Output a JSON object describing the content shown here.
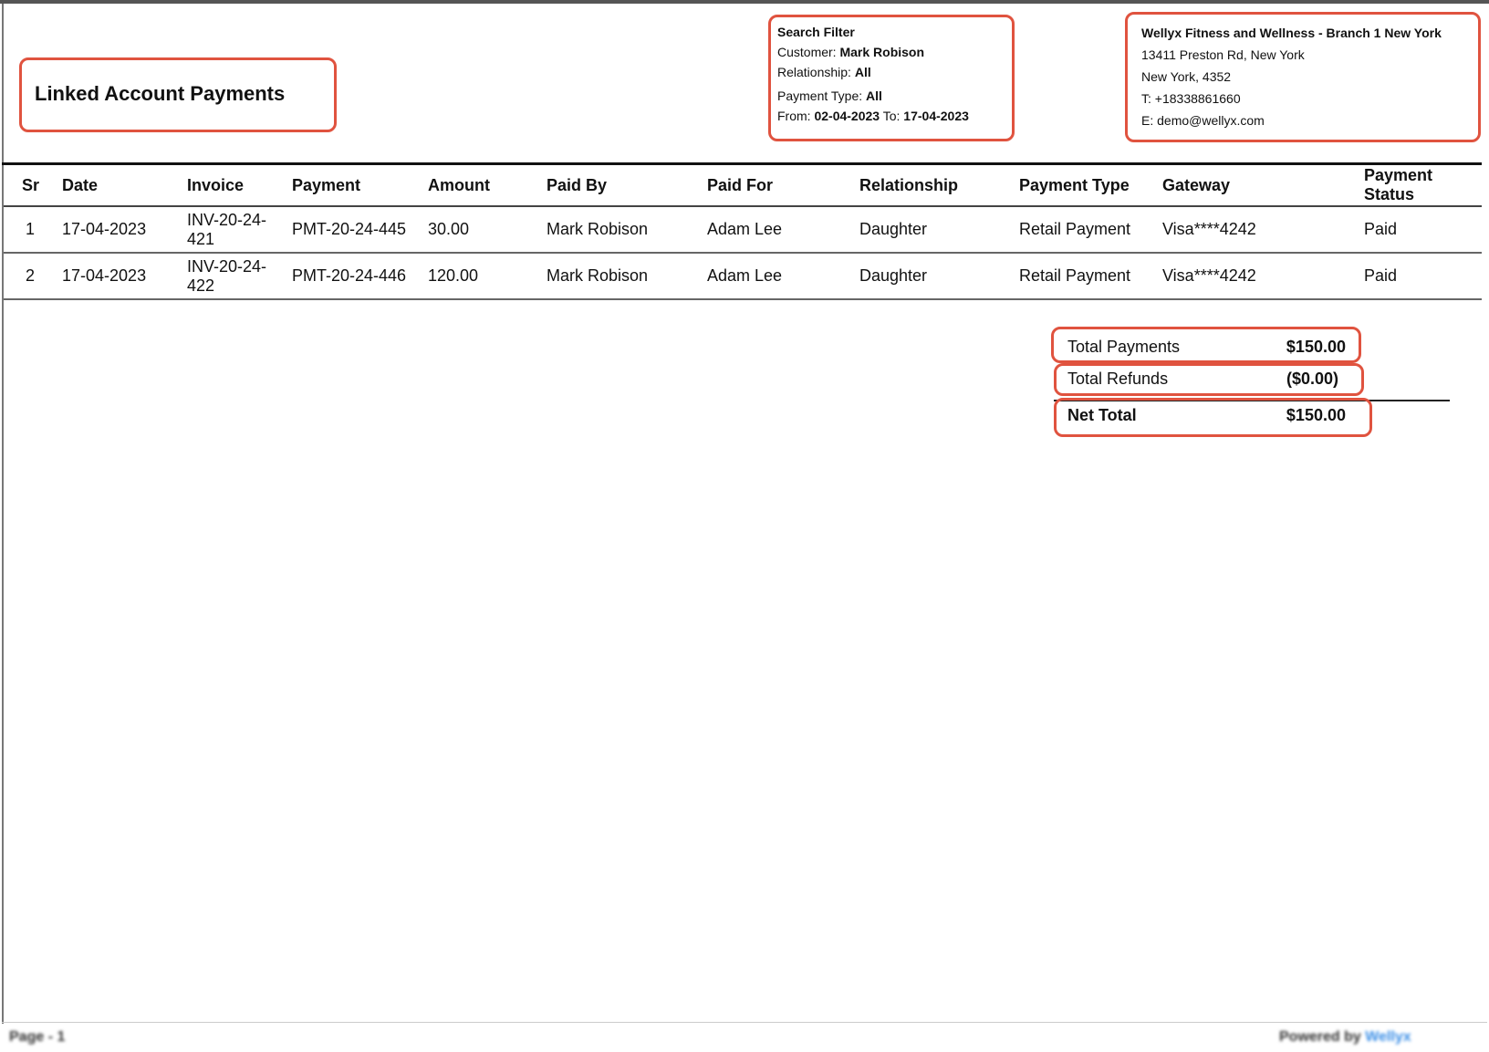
{
  "report": {
    "title": "Linked Account Payments"
  },
  "filter": {
    "heading": "Search Filter",
    "customer_label": "Customer:",
    "customer": "Mark Robison",
    "relationship_label": "Relationship:",
    "relationship": "All",
    "payment_type_label": "Payment Type:",
    "payment_type": "All",
    "from_label": "From:",
    "from": "02-04-2023",
    "to_label": "To:",
    "to": "17-04-2023"
  },
  "branch": {
    "name": "Wellyx Fitness and Wellness - Branch 1 New York",
    "address1": "13411 Preston Rd, New York",
    "address2": "New York, 4352",
    "phone": "T: +18338861660",
    "email": "E: demo@wellyx.com"
  },
  "table": {
    "headers": [
      "Sr",
      "Date",
      "Invoice",
      "Payment",
      "Amount",
      "Paid By",
      "Paid For",
      "Relationship",
      "Payment Type",
      "Gateway",
      "Payment Status"
    ],
    "rows": [
      [
        "1",
        "17-04-2023",
        "INV-20-24-421",
        "PMT-20-24-445",
        "30.00",
        "Mark Robison",
        "Adam Lee",
        "Daughter",
        "Retail Payment",
        "Visa****4242",
        "Paid"
      ],
      [
        "2",
        "17-04-2023",
        "INV-20-24-422",
        "PMT-20-24-446",
        "120.00",
        "Mark Robison",
        "Adam Lee",
        "Daughter",
        "Retail Payment",
        "Visa****4242",
        "Paid"
      ]
    ]
  },
  "totals": {
    "payments_label": "Total Payments",
    "payments": "$150.00",
    "refunds_label": "Total Refunds",
    "refunds": "($0.00)",
    "net_label": "Net Total",
    "net": "$150.00"
  },
  "footer": {
    "page": "Page - 1",
    "powered_by": "Powered by",
    "brand": "Wellyx"
  },
  "colors": {
    "highlight": "#e0533f"
  }
}
